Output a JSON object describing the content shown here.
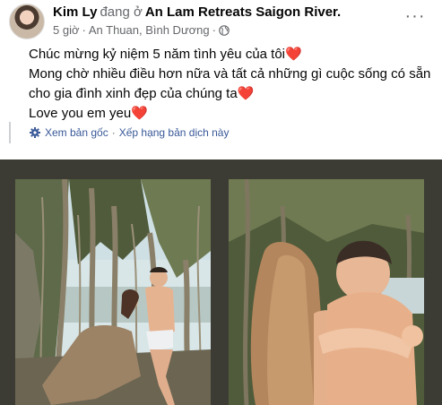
{
  "post": {
    "author": "Kim Ly",
    "verb": "đang ở",
    "place": "An Lam Retreats Saigon River.",
    "time": "5 giờ",
    "separator": "·",
    "location": "An Thuan, Bình Dương",
    "separator2": "·",
    "privacy_icon": "globe-icon",
    "more_label": "···"
  },
  "content": {
    "line1": "Chúc mừng kỷ niệm 5 năm tình yêu của tôi",
    "line2": "Mong chờ nhiều điều hơn nữa và tất cả những gì cuộc sống có sẵn",
    "line3": "cho gia đình xinh đẹp của chúng ta",
    "line4": "Love you em yeu",
    "heart": "❤️"
  },
  "translate": {
    "icon": "gear-icon",
    "see_original": "Xem bản gốc",
    "dot": "·",
    "rate": "Xếp hạng bản dịch này"
  },
  "colors": {
    "link": "#385898",
    "secondary": "#65676b",
    "heart": "#e41e3f",
    "photo_bg": "#3c3c34"
  }
}
